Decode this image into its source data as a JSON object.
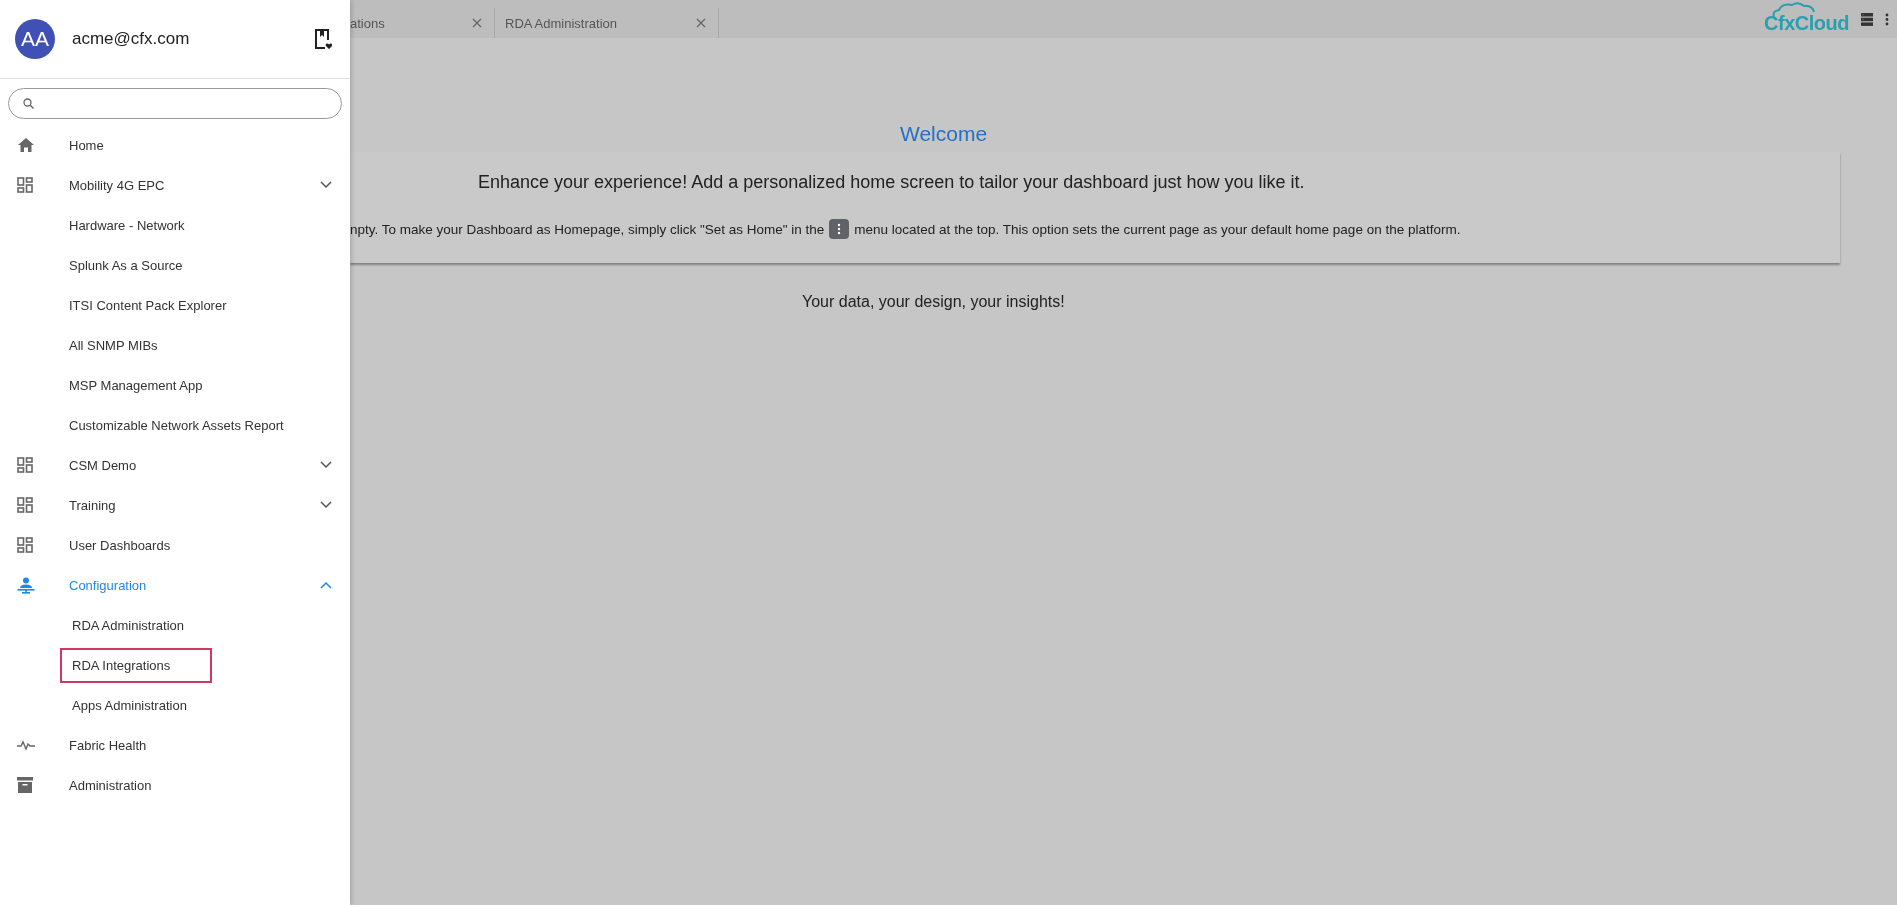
{
  "sidebar": {
    "user": {
      "initials": "AA",
      "email": "acme@cfx.com"
    },
    "items": [
      {
        "label": "Home",
        "kind": "home",
        "active": false
      },
      {
        "label": "Mobility 4G EPC",
        "kind": "dashboard",
        "active": false,
        "expanded": false,
        "children": [
          {
            "label": "Hardware - Network",
            "outlined": false
          },
          {
            "label": "Splunk As a Source",
            "outlined": false
          },
          {
            "label": "ITSI Content Pack Explorer",
            "outlined": false
          },
          {
            "label": "All SNMP MIBs",
            "outlined": false
          },
          {
            "label": "MSP Management App",
            "outlined": false
          },
          {
            "label": "Customizable Network Assets Report",
            "outlined": false
          }
        ]
      },
      {
        "label": "CSM Demo",
        "kind": "dashboard",
        "active": false,
        "expanded": false
      },
      {
        "label": "Training",
        "kind": "dashboard",
        "active": false,
        "expanded": false
      },
      {
        "label": "User Dashboards",
        "kind": "dashboard",
        "active": false
      },
      {
        "label": "Configuration",
        "kind": "config",
        "active": true,
        "expanded": true,
        "children": [
          {
            "label": "RDA Administration",
            "outlined": false
          },
          {
            "label": "RDA Integrations",
            "outlined": true
          },
          {
            "label": "Apps Administration",
            "outlined": false
          }
        ]
      },
      {
        "label": "Fabric Health",
        "kind": "pulse",
        "active": false
      },
      {
        "label": "Administration",
        "kind": "archive",
        "active": false
      }
    ]
  },
  "tabs": [
    {
      "label": "ations"
    },
    {
      "label": "RDA Administration"
    }
  ],
  "logo": {
    "text": "CfxCloud"
  },
  "main": {
    "heading": "Welcome",
    "card": {
      "title": "Enhance your experience! Add a personalized home screen to tailor your dashboard just how you like it.",
      "body_before": "npty. To make your Dashboard as Homepage, simply click \"Set as Home\" in the",
      "body_after": "menu located at the top. This option sets the current page as your default home page on the platform."
    },
    "tagline": "Your data, your design, your insights!"
  }
}
